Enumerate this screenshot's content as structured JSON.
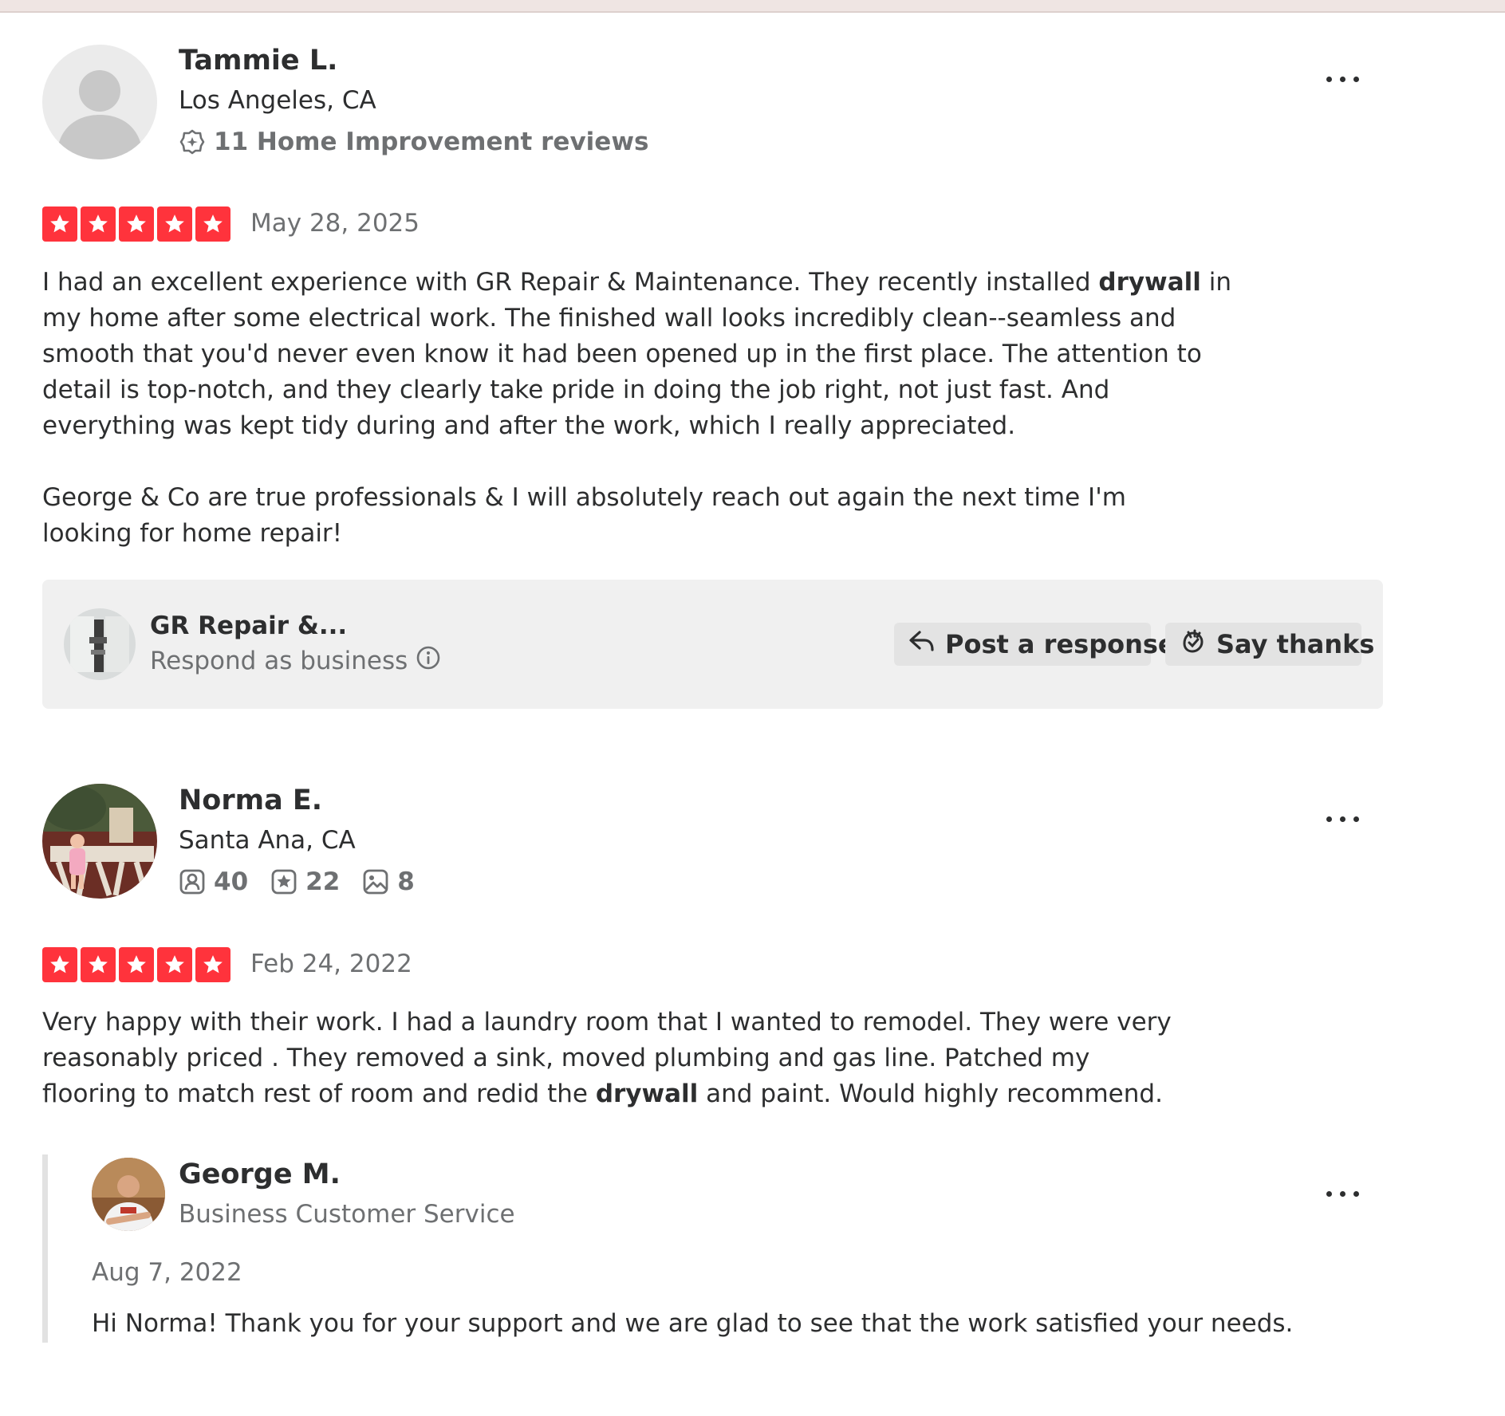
{
  "colors": {
    "star_red": "#ff333c",
    "text_primary": "#2d2e2f",
    "text_secondary": "#6e7072",
    "biz_box_bg": "#f0f0f0",
    "button_bg": "#e3e3e3"
  },
  "reviews": [
    {
      "user": {
        "name": "Tammie L.",
        "location": "Los Angeles, CA",
        "stat_text": "11 Home Improvement reviews",
        "stat_icon": "expertise-icon",
        "avatar": "default-avatar"
      },
      "rating": 5,
      "date": "May 28, 2025",
      "paragraphs": [
        [
          {
            "t": "I had an excellent experience with GR Repair & Maintenance. They recently installed ",
            "b": false
          },
          {
            "t": "drywall",
            "b": true
          },
          {
            "t": " in my home after some electrical work. The finished wall looks incredibly clean--seamless and smooth that you'd never even know it had been opened up in the first place. The attention to detail is top-notch, and they clearly take pride in doing the job right, not just fast. And everything was kept tidy during and after the work, which I really appreciated.",
            "b": false
          }
        ],
        [
          {
            "t": "George & Co are true professionals & I will absolutely reach out again the next time I'm looking for home repair!",
            "b": false
          }
        ]
      ],
      "business_box": {
        "name": "GR Repair &...",
        "subtitle": "Respond as business",
        "post_response_label": "Post a response",
        "say_thanks_label": "Say thanks"
      }
    },
    {
      "user": {
        "name": "Norma E.",
        "location": "Santa Ana, CA",
        "friends": "40",
        "reviews": "22",
        "photos": "8",
        "avatar": "photo-avatar"
      },
      "rating": 5,
      "date": "Feb 24, 2022",
      "paragraphs": [
        [
          {
            "t": "Very happy with their work. I had a laundry room that I wanted to remodel. They were very reasonably priced . They removed a sink, moved plumbing and gas line. Patched my flooring to match rest of room and redid the ",
            "b": false
          },
          {
            "t": "drywall",
            "b": true
          },
          {
            "t": " and paint. Would highly recommend.",
            "b": false
          }
        ]
      ],
      "owner_reply": {
        "name": "George M.",
        "role": "Business Customer Service",
        "date": "Aug 7, 2022",
        "text": "Hi Norma! Thank you for your support and we are glad to see that the work satisfied your needs."
      }
    }
  ]
}
